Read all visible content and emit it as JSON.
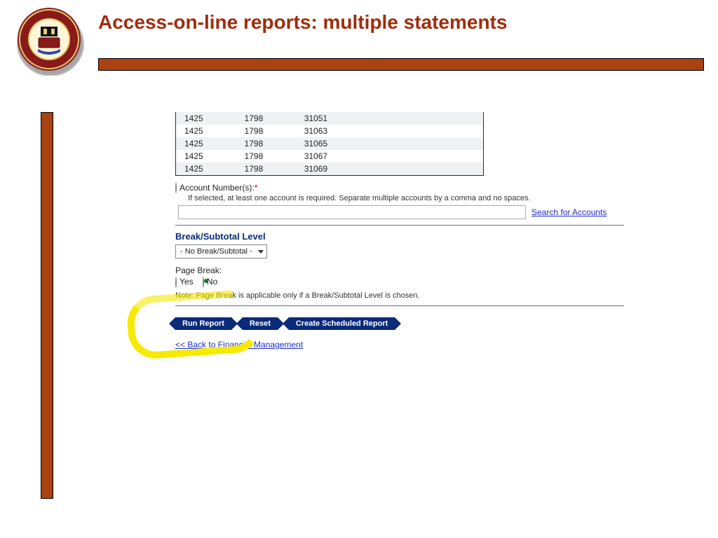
{
  "title": "Access-on-line reports: multiple statements",
  "table": {
    "rows": [
      {
        "c0": "1425",
        "c1": "1798",
        "c2": "31051"
      },
      {
        "c0": "1425",
        "c1": "1798",
        "c2": "31063"
      },
      {
        "c0": "1425",
        "c1": "1798",
        "c2": "31065"
      },
      {
        "c0": "1425",
        "c1": "1798",
        "c2": "31067"
      },
      {
        "c0": "1425",
        "c1": "1798",
        "c2": "31069"
      }
    ]
  },
  "acct": {
    "label": "Account Number(s):",
    "req": "*",
    "hint": "If selected, at least one account is required. Separate multiple accounts by a comma and no spaces.",
    "value": "",
    "search": "Search for Accounts"
  },
  "break": {
    "header": "Break/Subtotal Level",
    "selected": "- No Break/Subtotal -"
  },
  "pagebreak": {
    "label": "Page Break:",
    "yes": "Yes",
    "no": "No",
    "note": "Note: Page Break is applicable only if a Break/Subtotal Level is chosen."
  },
  "buttons": {
    "run": "Run Report",
    "reset": "Reset",
    "schedule": "Create Scheduled Report"
  },
  "back": "<< Back to Financial Management"
}
